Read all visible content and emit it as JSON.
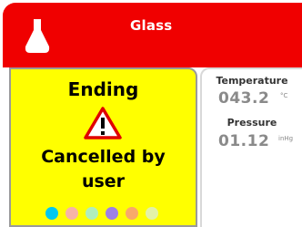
{
  "header": {
    "title": "Glass",
    "icon": "flask-icon"
  },
  "status": {
    "title": "Ending",
    "icon": "warning-icon",
    "message_line1": "Cancelled by",
    "message_line2": "user",
    "dot_colors": [
      "#00c8f0",
      "#f7b3a8",
      "#b0eebc",
      "#9e7fe6",
      "#f8a96a",
      "#e3f2a8"
    ]
  },
  "readings": {
    "temperature": {
      "label": "Temperature",
      "value": "043.2",
      "unit": "°C"
    },
    "pressure": {
      "label": "Pressure",
      "value": "01.12",
      "unit": "inHg"
    }
  },
  "colors": {
    "header": "#f00000",
    "status_panel": "#ffff00"
  }
}
